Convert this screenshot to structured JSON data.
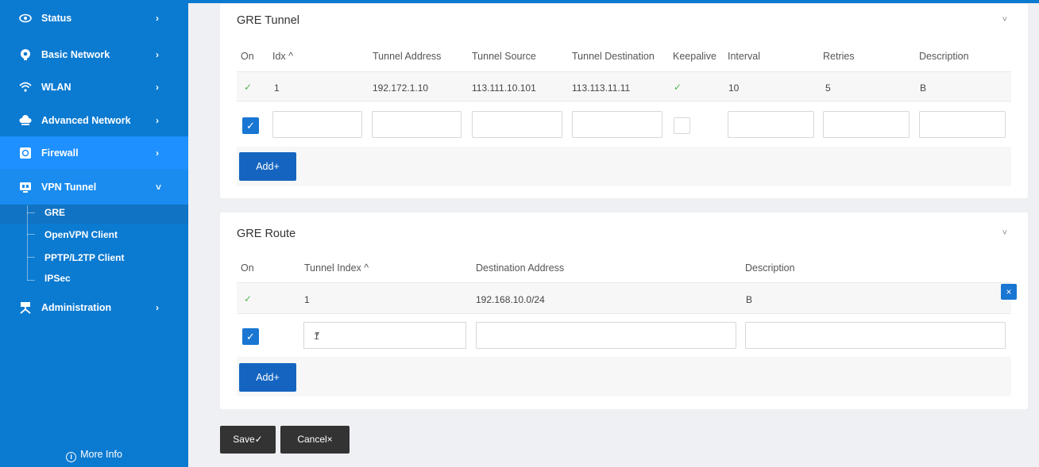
{
  "sidebar": {
    "items": [
      {
        "label": "Status",
        "icon": "eye-icon"
      },
      {
        "label": "Basic Network",
        "icon": "globe-icon"
      },
      {
        "label": "WLAN",
        "icon": "wifi-icon"
      },
      {
        "label": "Advanced Network",
        "icon": "cloud-icon"
      },
      {
        "label": "Firewall",
        "icon": "firewall-icon"
      },
      {
        "label": "VPN Tunnel",
        "icon": "vpn-icon"
      },
      {
        "label": "Administration",
        "icon": "admin-icon"
      }
    ],
    "subitems": [
      "GRE",
      "OpenVPN Client",
      "PPTP/L2TP Client",
      "IPSec"
    ],
    "more_info": "More Info",
    "info_icon_glyph": "i",
    "expanded_chevron": "˅",
    "chevron": "›"
  },
  "gre_tunnel": {
    "title": "GRE Tunnel",
    "collapse_glyph": "˅",
    "headers": [
      "On",
      "Idx ^",
      "Tunnel Address",
      "Tunnel Source",
      "Tunnel Destination",
      "Keepalive",
      "Interval",
      "Retries",
      "Description"
    ],
    "row": {
      "on": "✓",
      "idx": "1",
      "tunnel_address": "192.172.1.10",
      "tunnel_source": "113.111.10.101",
      "tunnel_destination": "113.113.11.11",
      "keepalive": "✓",
      "interval": "10",
      "retries": "5",
      "description": "B"
    },
    "new_on_checked": "✓",
    "add_label": "Add+"
  },
  "gre_route": {
    "title": "GRE Route",
    "collapse_glyph": "˅",
    "headers": [
      "On",
      "Tunnel Index ^",
      "Destination Address",
      "Description"
    ],
    "row": {
      "on": "✓",
      "tunnel_index": "1",
      "destination_address": "192.168.10.0/24",
      "description": "B",
      "delete_glyph": "×"
    },
    "new_on_checked": "✓",
    "tunnel_index_select": "1",
    "select_arrow": "▼",
    "add_label": "Add+"
  },
  "actions": {
    "save": "Save✓",
    "cancel": "Cancel×"
  },
  "colors": {
    "sidebar": "#0b7ad1",
    "active": "#1e90ff",
    "button": "#1565c0",
    "dark_button": "#333333",
    "check": "#4fb84f"
  }
}
